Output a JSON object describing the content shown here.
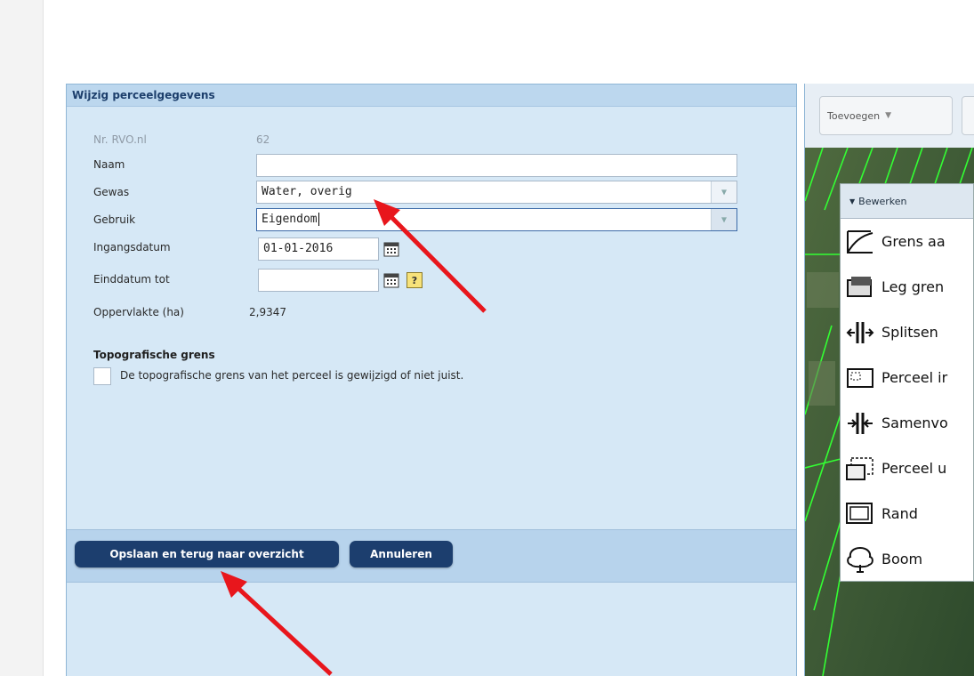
{
  "panel": {
    "title": "Wijzig perceelgegevens",
    "fields": {
      "nr_label": "Nr. RVO.nl",
      "nr_value": "62",
      "naam_label": "Naam",
      "naam_value": "",
      "gewas_label": "Gewas",
      "gewas_value": "Water, overig",
      "gebruik_label": "Gebruik",
      "gebruik_value": "Eigendom",
      "ingangsdatum_label": "Ingangsdatum",
      "ingangsdatum_value": "01-01-2016",
      "einddatum_label": "Einddatum tot",
      "einddatum_value": "",
      "help_label": "?",
      "oppervlakte_label": "Oppervlakte (ha)",
      "oppervlakte_value": "2,9347"
    },
    "topo": {
      "title": "Topografische grens",
      "checkbox_label": "De topografische grens van het perceel is gewijzigd of niet juist.",
      "checked": false
    },
    "buttons": {
      "save": "Opslaan en terug naar overzicht",
      "cancel": "Annuleren"
    }
  },
  "map": {
    "toolbar": {
      "add": "Toevoegen"
    },
    "menu": {
      "header": "Bewerken",
      "items": [
        "Grens aa",
        "Leg gren",
        "Splitsen",
        "Perceel ir",
        "Samenvo",
        "Perceel u",
        "Rand",
        "Boom"
      ]
    }
  },
  "colors": {
    "panel_bg": "#d6e8f6",
    "button_bg": "#1c3e6e",
    "arrow": "#e8161c",
    "parcel_line": "#33ff33"
  }
}
